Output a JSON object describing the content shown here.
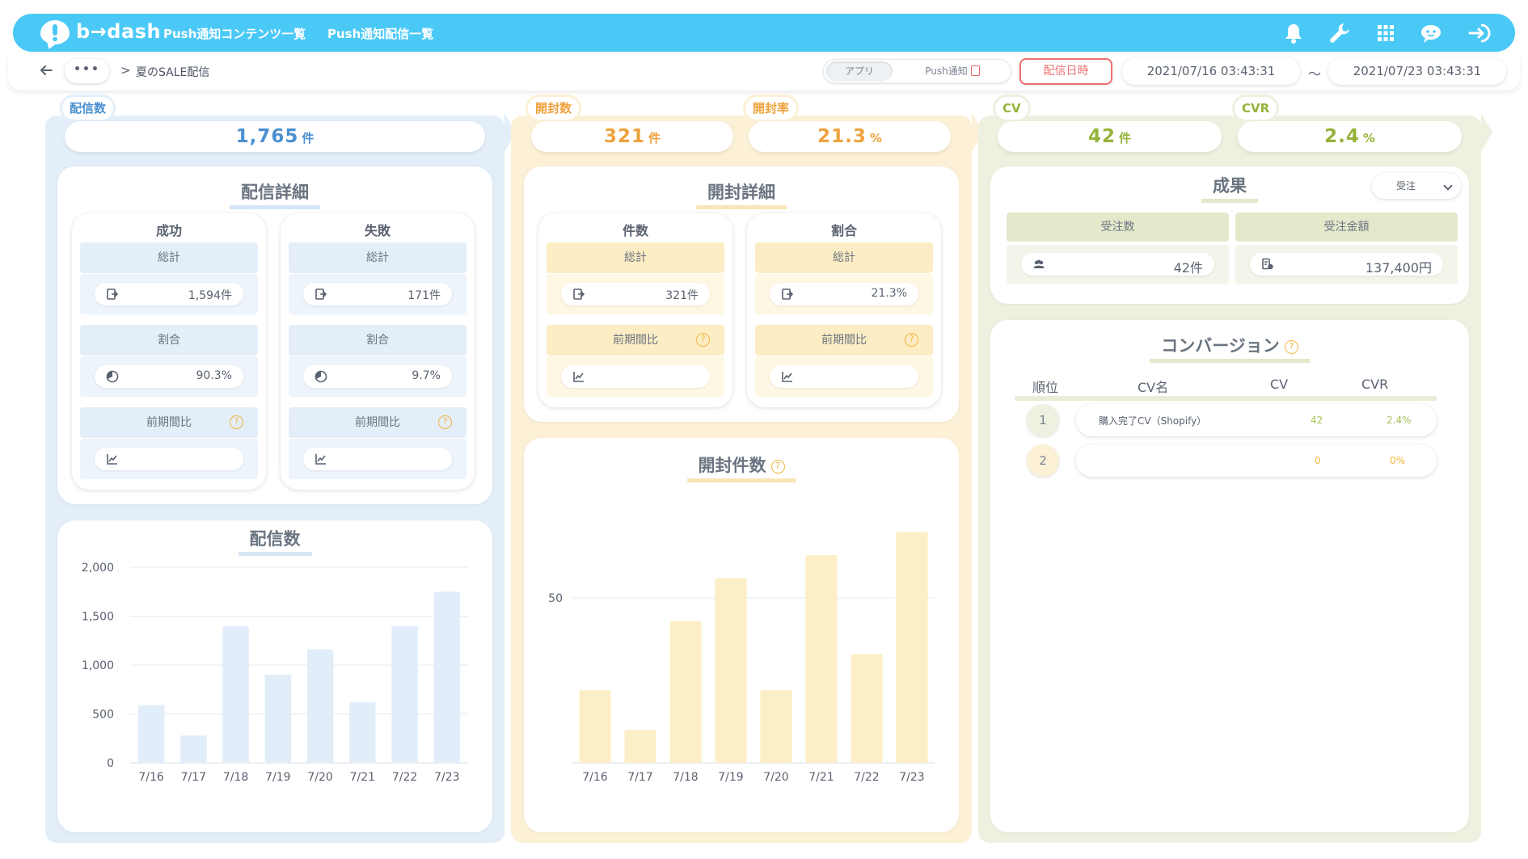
{
  "header": {
    "logo_text": "b→dash",
    "nav": [
      "Push通知コンテンツ一覧",
      "Push通知配信一覧"
    ],
    "icons": [
      "bell-icon",
      "wrench-icon",
      "grid-icon",
      "support-chat-icon",
      "logout-icon"
    ]
  },
  "subbar": {
    "more": "•••",
    "separator": ">",
    "breadcrumb": "夏のSALE配信",
    "segment": [
      "アプリ",
      "Push通知"
    ],
    "date_button": "配信日時",
    "date_from": "2021/07/16 03:43:31",
    "tilde": "〜",
    "date_to": "2021/07/23 03:43:31"
  },
  "colors": {
    "blue": "#4a90d0",
    "yellow": "#eea23c",
    "green": "#95b33a",
    "accent_red": "#ee6f6f",
    "topbar": "#4ac9f7"
  },
  "summary": {
    "sent": {
      "label": "配信数",
      "value": "1,765",
      "unit": "件"
    },
    "opened": {
      "label": "開封数",
      "value": "321",
      "unit": "件"
    },
    "open_rate": {
      "label": "開封率",
      "value": "21.3",
      "unit": "%"
    },
    "cv": {
      "label": "CV",
      "value": "42",
      "unit": "件"
    },
    "cvr": {
      "label": "CVR",
      "value": "2.4",
      "unit": "%"
    }
  },
  "delivery_detail": {
    "title": "配信詳細",
    "success": {
      "title": "成功",
      "total_label": "総計",
      "total": "1,594件",
      "ratio_label": "割合",
      "ratio": "90.3%",
      "compare_label": "前期間比",
      "compare": ""
    },
    "failure": {
      "title": "失敗",
      "total_label": "総計",
      "total": "171件",
      "ratio_label": "割合",
      "ratio": "9.7%",
      "compare_label": "前期間比",
      "compare": ""
    }
  },
  "open_detail": {
    "title": "開封詳細",
    "count": {
      "title": "件数",
      "total_label": "総計",
      "total": "321件",
      "compare_label": "前期間比",
      "compare": ""
    },
    "ratio": {
      "title": "割合",
      "total_label": "総計",
      "total": "21.3%",
      "compare_label": "前期間比",
      "compare": ""
    }
  },
  "results": {
    "title": "成果",
    "select_value": "受注",
    "orders_label": "受注数",
    "orders": "42件",
    "amount_label": "受注金額",
    "amount": "137,400円"
  },
  "conversion": {
    "title": "コンバージョン",
    "headers": [
      "順位",
      "CV名",
      "CV",
      "CVR"
    ],
    "rows": [
      {
        "rank": "1",
        "name": "購入完了CV（Shopify）",
        "cv": "42",
        "cvr": "2.4%"
      },
      {
        "rank": "2",
        "name": "",
        "cv": "0",
        "cvr": "0%"
      }
    ]
  },
  "chart_data": [
    {
      "type": "bar",
      "title": "配信数",
      "categories": [
        "7/16",
        "7/17",
        "7/18",
        "7/19",
        "7/20",
        "7/21",
        "7/22",
        "7/23"
      ],
      "values": [
        590,
        280,
        1400,
        900,
        1160,
        620,
        1400,
        1750
      ],
      "ylim": [
        0,
        2000
      ],
      "yticks": [
        "2,000",
        "1,500",
        "1,000",
        "500",
        "0"
      ],
      "color": "#e1edf8",
      "grid": true
    },
    {
      "type": "bar",
      "title": "開封件数",
      "categories": [
        "7/16",
        "7/17",
        "7/18",
        "7/19",
        "7/20",
        "7/21",
        "7/22",
        "7/23"
      ],
      "values": [
        22,
        10,
        43,
        56,
        22,
        63,
        33,
        70
      ],
      "ylim": [
        0,
        75
      ],
      "yticks": [
        "50"
      ],
      "color": "#fcefc7",
      "grid": true
    }
  ]
}
